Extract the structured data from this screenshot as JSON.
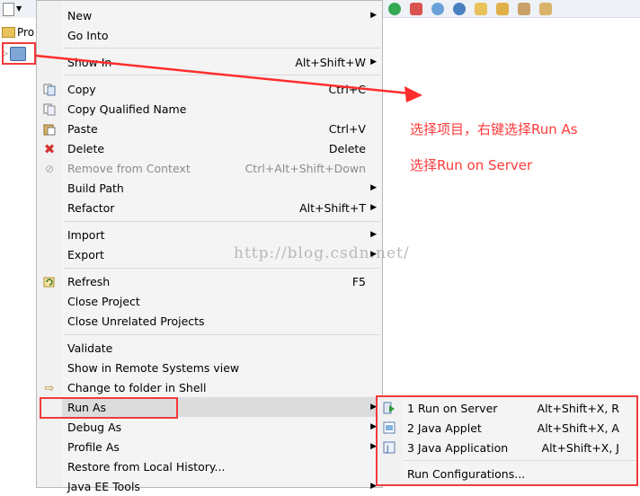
{
  "explorer": {
    "title": "Pro"
  },
  "menu": {
    "items": [
      {
        "label": "New",
        "accel": "",
        "submenu": true
      },
      {
        "label": "Go Into",
        "accel": ""
      },
      {
        "label": "Show In",
        "accel": "Alt+Shift+W",
        "submenu": true
      },
      {
        "label": "Copy",
        "accel": "Ctrl+C"
      },
      {
        "label": "Copy Qualified Name",
        "accel": ""
      },
      {
        "label": "Paste",
        "accel": "Ctrl+V"
      },
      {
        "label": "Delete",
        "accel": "Delete"
      },
      {
        "label": "Remove from Context",
        "accel": "Ctrl+Alt+Shift+Down",
        "disabled": true
      },
      {
        "label": "Build Path",
        "accel": "",
        "submenu": true
      },
      {
        "label": "Refactor",
        "accel": "Alt+Shift+T",
        "submenu": true
      },
      {
        "label": "Import",
        "accel": "",
        "submenu": true
      },
      {
        "label": "Export",
        "accel": "",
        "submenu": true
      },
      {
        "label": "Refresh",
        "accel": "F5"
      },
      {
        "label": "Close Project",
        "accel": ""
      },
      {
        "label": "Close Unrelated Projects",
        "accel": ""
      },
      {
        "label": "Validate",
        "accel": ""
      },
      {
        "label": "Show in Remote Systems view",
        "accel": ""
      },
      {
        "label": "Change to folder in Shell",
        "accel": ""
      },
      {
        "label": "Run As",
        "accel": "",
        "submenu": true,
        "highlighted": true
      },
      {
        "label": "Debug As",
        "accel": "",
        "submenu": true
      },
      {
        "label": "Profile As",
        "accel": "",
        "submenu": true
      },
      {
        "label": "Restore from Local History...",
        "accel": ""
      },
      {
        "label": "Java EE Tools",
        "accel": "",
        "submenu": true
      }
    ]
  },
  "submenu": {
    "items": [
      {
        "label": "1 Run on Server",
        "accel": "Alt+Shift+X, R"
      },
      {
        "label": "2 Java Applet",
        "accel": "Alt+Shift+X, A"
      },
      {
        "label": "3 Java Application",
        "accel": "Alt+Shift+X, J"
      },
      {
        "label": "Run Configurations...",
        "accel": ""
      }
    ]
  },
  "annotations": {
    "line1": "选择项目，右键选择Run As",
    "line2": "选择Run on Server"
  },
  "watermark": "http://blog.csdn.net/",
  "colors": {
    "annotation_red": "#ff3b3b",
    "menu_bg": "#f4f4f4",
    "highlight": "#dcdcdc"
  }
}
